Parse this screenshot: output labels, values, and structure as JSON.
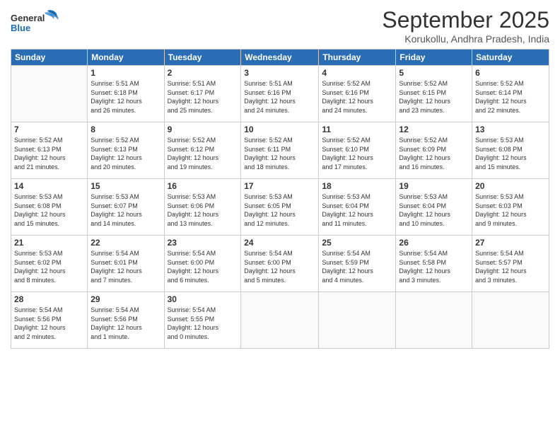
{
  "header": {
    "logo_general": "General",
    "logo_blue": "Blue",
    "month": "September 2025",
    "location": "Korukollu, Andhra Pradesh, India"
  },
  "weekdays": [
    "Sunday",
    "Monday",
    "Tuesday",
    "Wednesday",
    "Thursday",
    "Friday",
    "Saturday"
  ],
  "weeks": [
    [
      {
        "day": null,
        "info": null
      },
      {
        "day": "1",
        "info": "Sunrise: 5:51 AM\nSunset: 6:18 PM\nDaylight: 12 hours\nand 26 minutes."
      },
      {
        "day": "2",
        "info": "Sunrise: 5:51 AM\nSunset: 6:17 PM\nDaylight: 12 hours\nand 25 minutes."
      },
      {
        "day": "3",
        "info": "Sunrise: 5:51 AM\nSunset: 6:16 PM\nDaylight: 12 hours\nand 24 minutes."
      },
      {
        "day": "4",
        "info": "Sunrise: 5:52 AM\nSunset: 6:16 PM\nDaylight: 12 hours\nand 24 minutes."
      },
      {
        "day": "5",
        "info": "Sunrise: 5:52 AM\nSunset: 6:15 PM\nDaylight: 12 hours\nand 23 minutes."
      },
      {
        "day": "6",
        "info": "Sunrise: 5:52 AM\nSunset: 6:14 PM\nDaylight: 12 hours\nand 22 minutes."
      }
    ],
    [
      {
        "day": "7",
        "info": "Sunrise: 5:52 AM\nSunset: 6:13 PM\nDaylight: 12 hours\nand 21 minutes."
      },
      {
        "day": "8",
        "info": "Sunrise: 5:52 AM\nSunset: 6:13 PM\nDaylight: 12 hours\nand 20 minutes."
      },
      {
        "day": "9",
        "info": "Sunrise: 5:52 AM\nSunset: 6:12 PM\nDaylight: 12 hours\nand 19 minutes."
      },
      {
        "day": "10",
        "info": "Sunrise: 5:52 AM\nSunset: 6:11 PM\nDaylight: 12 hours\nand 18 minutes."
      },
      {
        "day": "11",
        "info": "Sunrise: 5:52 AM\nSunset: 6:10 PM\nDaylight: 12 hours\nand 17 minutes."
      },
      {
        "day": "12",
        "info": "Sunrise: 5:52 AM\nSunset: 6:09 PM\nDaylight: 12 hours\nand 16 minutes."
      },
      {
        "day": "13",
        "info": "Sunrise: 5:53 AM\nSunset: 6:08 PM\nDaylight: 12 hours\nand 15 minutes."
      }
    ],
    [
      {
        "day": "14",
        "info": "Sunrise: 5:53 AM\nSunset: 6:08 PM\nDaylight: 12 hours\nand 15 minutes."
      },
      {
        "day": "15",
        "info": "Sunrise: 5:53 AM\nSunset: 6:07 PM\nDaylight: 12 hours\nand 14 minutes."
      },
      {
        "day": "16",
        "info": "Sunrise: 5:53 AM\nSunset: 6:06 PM\nDaylight: 12 hours\nand 13 minutes."
      },
      {
        "day": "17",
        "info": "Sunrise: 5:53 AM\nSunset: 6:05 PM\nDaylight: 12 hours\nand 12 minutes."
      },
      {
        "day": "18",
        "info": "Sunrise: 5:53 AM\nSunset: 6:04 PM\nDaylight: 12 hours\nand 11 minutes."
      },
      {
        "day": "19",
        "info": "Sunrise: 5:53 AM\nSunset: 6:04 PM\nDaylight: 12 hours\nand 10 minutes."
      },
      {
        "day": "20",
        "info": "Sunrise: 5:53 AM\nSunset: 6:03 PM\nDaylight: 12 hours\nand 9 minutes."
      }
    ],
    [
      {
        "day": "21",
        "info": "Sunrise: 5:53 AM\nSunset: 6:02 PM\nDaylight: 12 hours\nand 8 minutes."
      },
      {
        "day": "22",
        "info": "Sunrise: 5:54 AM\nSunset: 6:01 PM\nDaylight: 12 hours\nand 7 minutes."
      },
      {
        "day": "23",
        "info": "Sunrise: 5:54 AM\nSunset: 6:00 PM\nDaylight: 12 hours\nand 6 minutes."
      },
      {
        "day": "24",
        "info": "Sunrise: 5:54 AM\nSunset: 6:00 PM\nDaylight: 12 hours\nand 5 minutes."
      },
      {
        "day": "25",
        "info": "Sunrise: 5:54 AM\nSunset: 5:59 PM\nDaylight: 12 hours\nand 4 minutes."
      },
      {
        "day": "26",
        "info": "Sunrise: 5:54 AM\nSunset: 5:58 PM\nDaylight: 12 hours\nand 3 minutes."
      },
      {
        "day": "27",
        "info": "Sunrise: 5:54 AM\nSunset: 5:57 PM\nDaylight: 12 hours\nand 3 minutes."
      }
    ],
    [
      {
        "day": "28",
        "info": "Sunrise: 5:54 AM\nSunset: 5:56 PM\nDaylight: 12 hours\nand 2 minutes."
      },
      {
        "day": "29",
        "info": "Sunrise: 5:54 AM\nSunset: 5:56 PM\nDaylight: 12 hours\nand 1 minute."
      },
      {
        "day": "30",
        "info": "Sunrise: 5:54 AM\nSunset: 5:55 PM\nDaylight: 12 hours\nand 0 minutes."
      },
      {
        "day": null,
        "info": null
      },
      {
        "day": null,
        "info": null
      },
      {
        "day": null,
        "info": null
      },
      {
        "day": null,
        "info": null
      }
    ]
  ]
}
